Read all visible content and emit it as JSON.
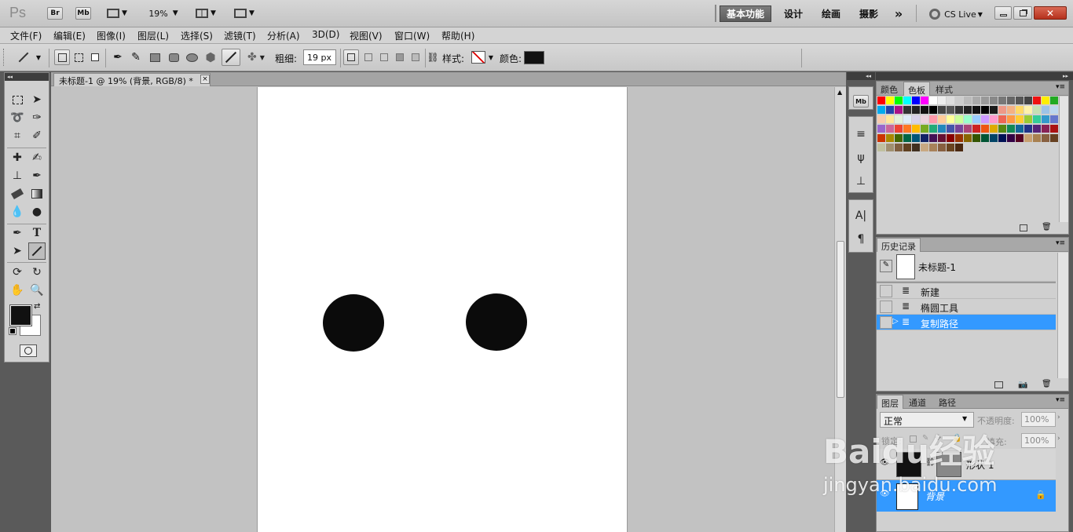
{
  "app": {
    "logo": "Ps",
    "bridge": "Br",
    "minibridge": "Mb",
    "zoom": "19%",
    "workspaces": [
      "基本功能",
      "设计",
      "绘画",
      "摄影"
    ],
    "more": "»",
    "cslive": "CS Live"
  },
  "menu": [
    "文件(F)",
    "编辑(E)",
    "图像(I)",
    "图层(L)",
    "选择(S)",
    "滤镜(T)",
    "分析(A)",
    "3D(D)",
    "视图(V)",
    "窗口(W)",
    "帮助(H)"
  ],
  "options": {
    "weight_label": "粗细:",
    "weight_value": "19 px",
    "style_label": "样式:",
    "color_label": "颜色:",
    "color": "#111111"
  },
  "document": {
    "tab_title": "未标题-1 @ 19% (背景, RGB/8) *",
    "close": "×"
  },
  "panels": {
    "swatch_tabs": [
      "颜色",
      "色板",
      "样式"
    ],
    "history_tab": "历史记录",
    "history_snapshot": "未标题-1",
    "history_items": [
      "新建",
      "椭圆工具",
      "复制路径"
    ],
    "layers_tabs": [
      "图层",
      "通道",
      "路径"
    ],
    "blend_mode": "正常",
    "opacity_label": "不透明度:",
    "opacity_value": "100%",
    "lock_label": "锁定:",
    "fill_label": "填充:",
    "fill_value": "100%",
    "layers": [
      "形状 1",
      "背景"
    ]
  },
  "watermark": {
    "brand": "Baidu经验",
    "url": "jingyan.baidu.com"
  },
  "colors": {
    "accent": "#3399ff",
    "foreground": "#111111",
    "background": "#ffffff",
    "canvas": "#ffffff"
  }
}
